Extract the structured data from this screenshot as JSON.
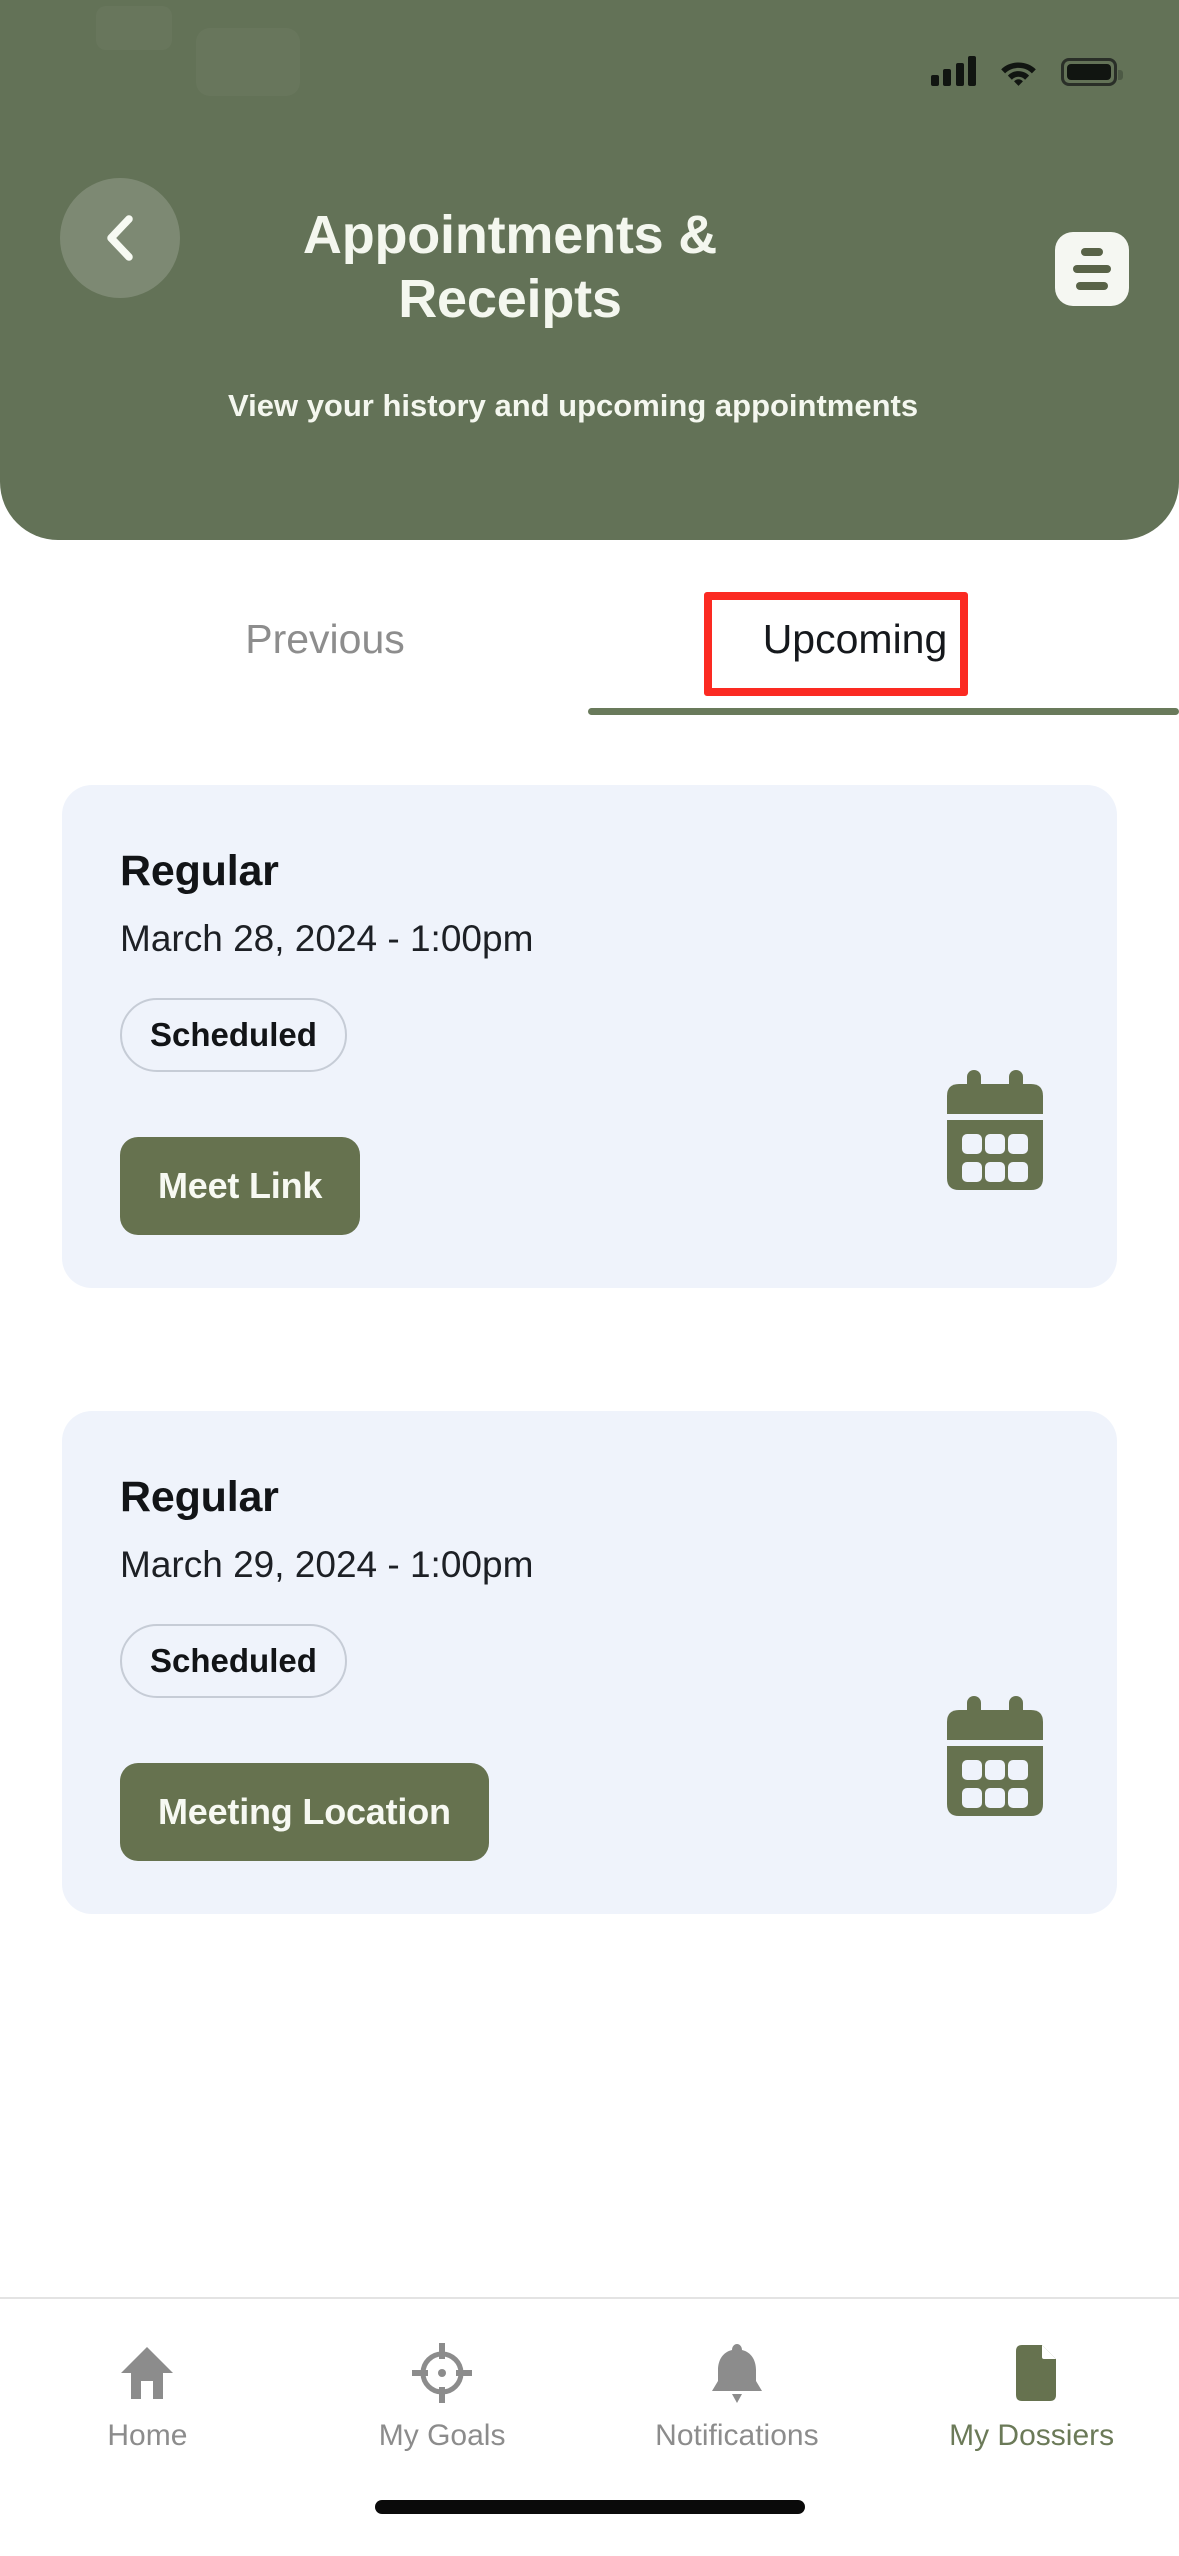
{
  "theme": {
    "header_green": "#637257",
    "accent_green": "#66724f",
    "card_bg": "#eff3fb",
    "highlight_red": "#fb2a22",
    "inactive_gray": "#8c8c8c"
  },
  "status_bar": {
    "cellular_icon": "cellular-signal-icon",
    "wifi_icon": "wifi-icon",
    "battery_icon": "battery-icon"
  },
  "header": {
    "back_icon": "chevron-left-icon",
    "title": "Appointments & Receipts",
    "subtitle": "View your history and upcoming appointments",
    "menu_icon": "list-menu-icon"
  },
  "tabs": {
    "items": [
      {
        "label": "Previous",
        "active": false
      },
      {
        "label": "Upcoming",
        "active": true
      }
    ],
    "highlighted": "Upcoming"
  },
  "appointments": [
    {
      "title": "Regular",
      "datetime": "March 28, 2024 - 1:00pm",
      "status": "Scheduled",
      "action_label": "Meet Link",
      "icon": "calendar-icon"
    },
    {
      "title": "Regular",
      "datetime": "March 29, 2024 - 1:00pm",
      "status": "Scheduled",
      "action_label": "Meeting Location",
      "icon": "calendar-icon"
    }
  ],
  "bottom_nav": {
    "items": [
      {
        "label": "Home",
        "icon": "home-icon",
        "active": false
      },
      {
        "label": "My Goals",
        "icon": "target-icon",
        "active": false
      },
      {
        "label": "Notifications",
        "icon": "bell-icon",
        "active": false
      },
      {
        "label": "My Dossiers",
        "icon": "document-icon",
        "active": true
      }
    ]
  }
}
